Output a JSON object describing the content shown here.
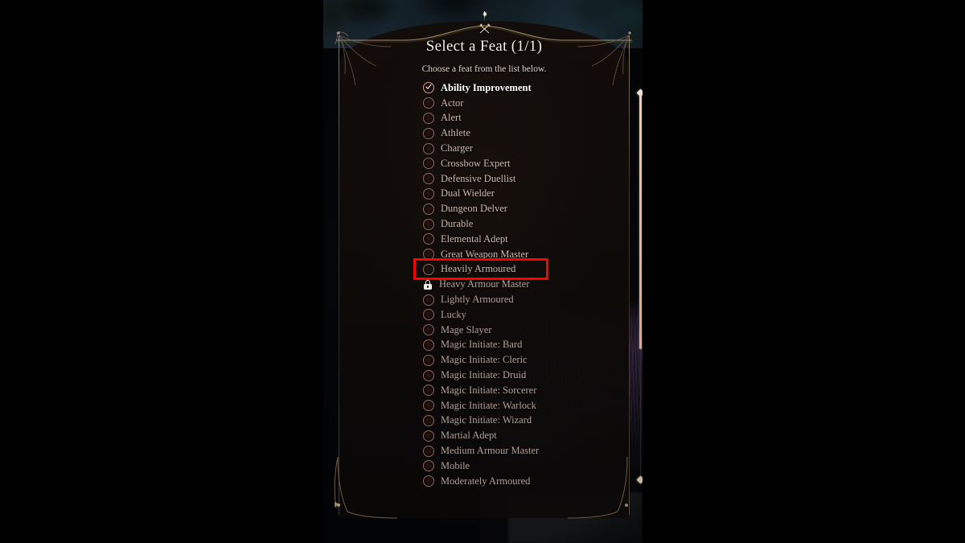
{
  "dialog": {
    "title": "Select a Feat (1/1)",
    "subtitle": "Choose a feat from the list below.",
    "crest_icon": "crossed-axes-crest-icon"
  },
  "colors": {
    "highlight": "#ff0000",
    "selected_text": "#ffffff",
    "item_text": "#cdb9ad",
    "scrollbar": "#e8bfa5",
    "frame_gold": "#c4aa78"
  },
  "scrollbar": {
    "orientation": "vertical",
    "thumb_position_percent": 0,
    "thumb_size_percent": 65,
    "top_cap_icon": "diamond-ornament-icon",
    "bottom_cap_icon": "diamond-ornament-icon"
  },
  "highlight": {
    "target": "Heavily Armoured",
    "shape": "rectangle"
  },
  "feats": [
    {
      "label": "Ability Improvement",
      "state": "selected",
      "icon": "radio-checked-icon"
    },
    {
      "label": "Actor",
      "state": "normal",
      "icon": "radio-unchecked-icon"
    },
    {
      "label": "Alert",
      "state": "normal",
      "icon": "radio-unchecked-icon"
    },
    {
      "label": "Athlete",
      "state": "normal",
      "icon": "radio-unchecked-icon"
    },
    {
      "label": "Charger",
      "state": "normal",
      "icon": "radio-unchecked-icon"
    },
    {
      "label": "Crossbow Expert",
      "state": "normal",
      "icon": "radio-unchecked-icon"
    },
    {
      "label": "Defensive Duellist",
      "state": "normal",
      "icon": "radio-unchecked-icon"
    },
    {
      "label": "Dual Wielder",
      "state": "normal",
      "icon": "radio-unchecked-icon"
    },
    {
      "label": "Dungeon Delver",
      "state": "normal",
      "icon": "radio-unchecked-icon"
    },
    {
      "label": "Durable",
      "state": "normal",
      "icon": "radio-unchecked-icon"
    },
    {
      "label": "Elemental Adept",
      "state": "normal",
      "icon": "radio-unchecked-icon"
    },
    {
      "label": "Great Weapon Master",
      "state": "normal",
      "icon": "radio-unchecked-icon"
    },
    {
      "label": "Heavily Armoured",
      "state": "highlighted",
      "icon": "radio-unchecked-icon"
    },
    {
      "label": "Heavy Armour Master",
      "state": "locked",
      "icon": "lock-icon"
    },
    {
      "label": "Lightly Armoured",
      "state": "normal",
      "icon": "radio-unchecked-icon"
    },
    {
      "label": "Lucky",
      "state": "normal",
      "icon": "radio-unchecked-icon"
    },
    {
      "label": "Mage Slayer",
      "state": "normal",
      "icon": "radio-unchecked-icon"
    },
    {
      "label": "Magic Initiate: Bard",
      "state": "normal",
      "icon": "radio-unchecked-icon"
    },
    {
      "label": "Magic Initiate: Cleric",
      "state": "normal",
      "icon": "radio-unchecked-icon"
    },
    {
      "label": "Magic Initiate: Druid",
      "state": "normal",
      "icon": "radio-unchecked-icon"
    },
    {
      "label": "Magic Initiate: Sorcerer",
      "state": "normal",
      "icon": "radio-unchecked-icon"
    },
    {
      "label": "Magic Initiate: Warlock",
      "state": "normal",
      "icon": "radio-unchecked-icon"
    },
    {
      "label": "Magic Initiate: Wizard",
      "state": "normal",
      "icon": "radio-unchecked-icon"
    },
    {
      "label": "Martial Adept",
      "state": "normal",
      "icon": "radio-unchecked-icon"
    },
    {
      "label": "Medium Armour Master",
      "state": "normal",
      "icon": "radio-unchecked-icon"
    },
    {
      "label": "Mobile",
      "state": "normal",
      "icon": "radio-unchecked-icon"
    },
    {
      "label": "Moderately Armoured",
      "state": "normal",
      "icon": "radio-unchecked-icon"
    }
  ]
}
